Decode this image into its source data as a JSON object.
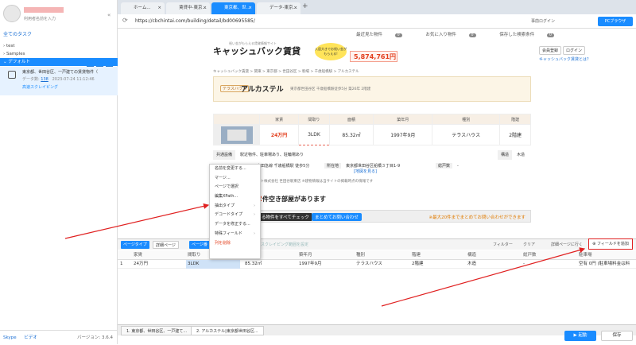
{
  "sidebar": {
    "user_link": "利用者名前を入力",
    "all_tasks": "全てのタスク",
    "tree": [
      {
        "label": "test"
      },
      {
        "label": "Samples"
      },
      {
        "label": "デフォルト"
      }
    ],
    "task": {
      "title": "東京都、世田谷区、一戸建ての賃貸物件（",
      "data_label": "データ数:",
      "data_count": "138",
      "date": "2023-07-24 11:12:46",
      "link": "高速スクレイピング"
    },
    "footer": {
      "skype": "Skype",
      "video": "ビデオ",
      "version": "バージョン: 3.6.4"
    }
  },
  "browser": {
    "tabs": [
      {
        "label": "ホーム..."
      },
      {
        "label": "賃貸中-東京..."
      },
      {
        "label": "東京都、世..."
      },
      {
        "label": "データ-東京..."
      }
    ],
    "url": "https://cbchintai.com/building/detail/bd00695585/",
    "login": "事前ログイン",
    "pc_btn": "PCブラウザ"
  },
  "site": {
    "nav": [
      {
        "label": "最近見た物件",
        "count": "0"
      },
      {
        "label": "お気に入り物件",
        "count": "0"
      },
      {
        "label": "保存した検索条件",
        "count": "0"
      }
    ],
    "brand": "キャッシュバック賃貸",
    "brand_sub": "祝い金がもらえる賃貸情報サイト",
    "badge": "入居大きでお祝い金がもらえる!",
    "cashback": "5,874,761円",
    "member": "会員登録",
    "login": "ログイン",
    "whatis": "キャッシュバック賃貸とは？",
    "crumb": "キャッシュバック賃貸 > 関東 > 東京都 > 世田谷区 > 駒場 > 千歳船橋駅 > アルカステル",
    "prop_tag": "テラスハウス",
    "prop_title": "アルカステル",
    "prop_addr": "東京都世田谷区 千歳船橋駅徒歩5分 築26年 2階建",
    "table_headers": [
      "",
      "家賃",
      "間取り",
      "面積",
      "築年月",
      "種別",
      "階建"
    ],
    "table_values": [
      "24万円",
      "3LDK",
      "85.32㎡",
      "1997年9月",
      "テラスハウス",
      "2階建"
    ],
    "facil_label": "共通設備",
    "facil_value": "駅近物件、駐車場あり、駐輪場あり",
    "struct_label": "構造",
    "struct_value": "木造",
    "access": "小田急線 千歳船橋駅 徒歩5分",
    "place_label": "所在地",
    "place_value": "東京都世田谷区船橋３丁目1-9",
    "map_link": "[地図を見る]",
    "nyuk_label": "総戸数",
    "nyuk_value": "-",
    "note": "ート株式会社 世田谷駅東店 ※建物情報は当サイトの掲載時点の情報です",
    "vac_num": "2",
    "vac_text": "件空き部屋があります",
    "check_all": "る物件をすべてチェック",
    "inq_btn": "まとめてお問い合わせ",
    "inq_text": "※最大20件までまとめてお問い合わせができます"
  },
  "context_menu": {
    "items": [
      {
        "label": "名前を変更する..."
      },
      {
        "label": "マージ..."
      },
      {
        "label": "ページで選択"
      },
      {
        "label": "編集XPath..."
      },
      {
        "label": "抽出タイプ"
      },
      {
        "label": "デコードタイプ"
      },
      {
        "label": "データを修正する..."
      },
      {
        "label": "特殊フィールド"
      },
      {
        "label": "列を削除"
      }
    ]
  },
  "toolbar": {
    "page_type": "ページタイプ",
    "detail_page": "詳細ページ",
    "page_num": "ページ番",
    "scrape_hint": "スクレイピング範囲を設定",
    "filter": "フィルター",
    "clear": "クリア",
    "detail_link": "詳細ページに行く",
    "fold": "折る",
    "add_field": "フィールドを追加"
  },
  "columns": {
    "headers": [
      "家賃",
      "間取り",
      "面積",
      "築年月",
      "種別",
      "階建",
      "構造",
      "総戸数",
      "駐車場"
    ]
  },
  "row": {
    "num": "1",
    "values": [
      "24万円",
      "3LDK",
      "85.32㎡",
      "1997年9月",
      "テラスハウス",
      "2階建",
      "木造",
      "-",
      "空有 0円 (駐車場料金は料"
    ]
  },
  "task_tabs": [
    {
      "label": "1. 東京都、世田谷区、一戸建て..."
    },
    {
      "label": "2. アルカステル|東京都世田谷区..."
    }
  ],
  "buttons": {
    "start": "起動",
    "save": "保存"
  }
}
